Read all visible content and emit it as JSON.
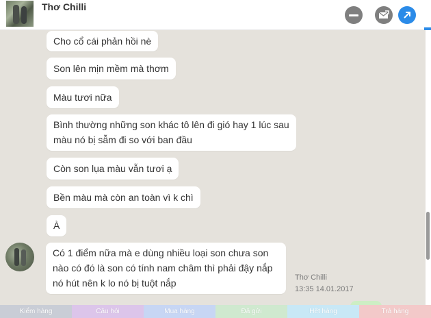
{
  "header": {
    "contact_name": "Thơ Chilli",
    "icons": [
      "minimize-icon",
      "mail-icon",
      "open-external-icon"
    ]
  },
  "messages": [
    {
      "text": "Cho cổ cái phản hồi nè"
    },
    {
      "text": "Son lên mịn mềm mà thơm"
    },
    {
      "text": "Màu tươi nữa"
    },
    {
      "line1": "Bình thường những son khác tô lên đi gió hay 1 lúc sau",
      "line2": "màu nó bị sẫm đi so với ban đầu"
    },
    {
      "text": "Còn son lụa màu vẫn tươi ạ"
    },
    {
      "text": "Bền màu mà còn an toàn vì k chì"
    },
    {
      "text": "À"
    },
    {
      "line1": "Có 1 điểm nữa mà e dùng nhiều loại son chưa son",
      "line2": "nào có đó là son có tính nam châm thì phải đậy nắp",
      "line3": "nó hút nên k lo nó bị tuột nắp"
    }
  ],
  "message_meta": {
    "sender": "Thơ Chilli",
    "timestamp": "13:35 14.01.2017"
  },
  "tags": [
    {
      "label": "Kiểm hàng",
      "color": "#c9cdd6"
    },
    {
      "label": "Câu hỏi",
      "color": "#dcc5ea"
    },
    {
      "label": "Mua hàng",
      "color": "#c7d6f4"
    },
    {
      "label": "Đã gửi",
      "color": "#cfe9cf"
    },
    {
      "label": "Hết hàng",
      "color": "#c8e8f6"
    },
    {
      "label": "Trả hàng",
      "color": "#f3c9c9"
    }
  ],
  "colors": {
    "chat_background": "#e5e2dc",
    "accent_blue": "#2b8be8",
    "icon_gray": "#7f7f7f"
  }
}
